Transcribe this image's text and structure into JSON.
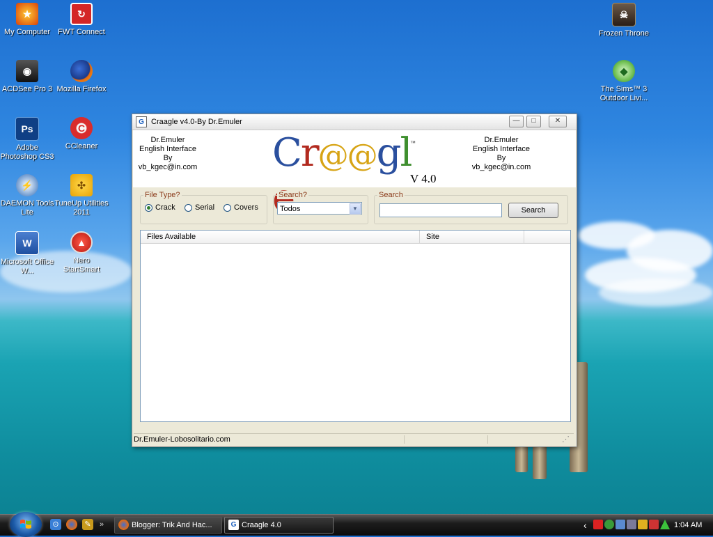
{
  "desktop": {
    "icons": [
      {
        "label": "My Computer",
        "icon": "my-computer-icon"
      },
      {
        "label": "FWT Connect",
        "icon": "fwt-connect-icon"
      },
      {
        "label": "ACDSee Pro 3",
        "icon": "acdsee-icon"
      },
      {
        "label": "Mozilla Firefox",
        "icon": "firefox-icon"
      },
      {
        "label": "Adobe Photoshop CS3",
        "icon": "photoshop-icon",
        "glyph": "Ps"
      },
      {
        "label": "CCleaner",
        "icon": "ccleaner-icon",
        "glyph": "C"
      },
      {
        "label": "DAEMON Tools Lite",
        "icon": "daemon-tools-icon"
      },
      {
        "label": "TuneUp Utilities 2011",
        "icon": "tuneup-icon"
      },
      {
        "label": "Microsoft Office W...",
        "icon": "word-icon",
        "glyph": "W"
      },
      {
        "label": "Nero StartSmart",
        "icon": "nero-icon"
      },
      {
        "label": "Frozen Throne",
        "icon": "frozen-throne-icon"
      },
      {
        "label": "The Sims™ 3 Outdoor Livi...",
        "icon": "sims-icon"
      }
    ]
  },
  "window": {
    "title": "Craagle v4.0-By Dr.Emuler",
    "app_icon_glyph": "G",
    "controls": {
      "minimize": "—",
      "maximize": "□",
      "close": "✕"
    },
    "credit_left": {
      "line1": "Dr.Emuler",
      "line2": "English Interface",
      "line3": "By",
      "line4": "vb_kgec@in.com"
    },
    "credit_right": {
      "line1": "Dr.Emuler",
      "line2": "English Interface",
      "line3": "By",
      "line4": "vb_kgec@in.com"
    },
    "logo": {
      "letters": [
        "C",
        "r",
        "@",
        "@",
        "g",
        "l",
        "e"
      ],
      "trademark": "™",
      "version": "V 4.0"
    },
    "file_type": {
      "label": "File Type?",
      "options": [
        {
          "label": "Crack",
          "selected": true
        },
        {
          "label": "Serial",
          "selected": false
        },
        {
          "label": "Covers",
          "selected": false
        }
      ]
    },
    "search_where": {
      "label": "Search?",
      "value": "Todos",
      "arrow": "▼"
    },
    "search": {
      "label": "Search",
      "value": "",
      "button": "Search"
    },
    "results": {
      "columns": [
        "Files Available",
        "Site",
        ""
      ]
    },
    "status": {
      "text": "Dr.Emuler-Lobosolitario.com",
      "grip": "⋰"
    }
  },
  "taskbar": {
    "quick_launch_more": "»",
    "tasks": [
      {
        "label": "Blogger: Trik And Hac...",
        "icon": "firefox-icon",
        "active": false
      },
      {
        "label": "Craagle 4.0",
        "icon": "craagle-icon",
        "active": true
      }
    ],
    "tray_expand": "‹",
    "clock": "1:04 AM"
  },
  "colors": {
    "logo": [
      "#2a4f9e",
      "#b22a1f",
      "#d7a415",
      "#d7a415",
      "#2a4f9e",
      "#3f8f2f",
      "#b22a1f"
    ],
    "group_label": "#8a3a1a"
  }
}
